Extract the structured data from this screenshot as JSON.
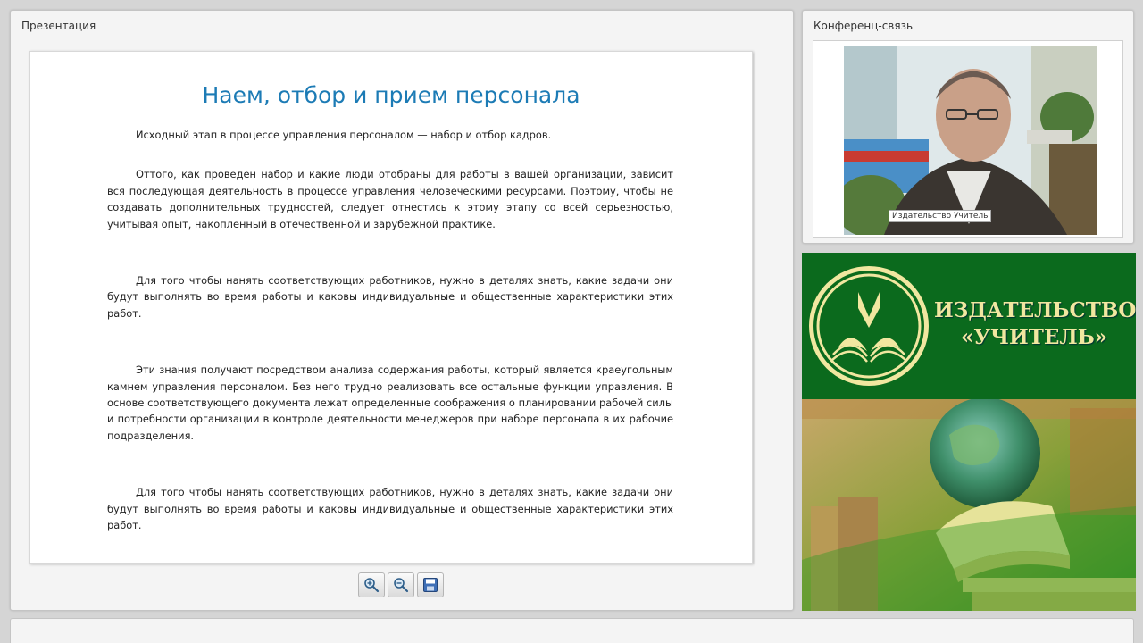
{
  "presentation": {
    "panel_title": "Презентация",
    "slide": {
      "title": "Наем, отбор и прием персонала",
      "paragraphs": [
        "Исходный этап в процессе управления персоналом — набор и отбор кадров.",
        "Оттого, как проведен набор и какие люди отобраны для работы в вашей организации, зависит вся последующая деятельность в процессе управления человеческими ресурсами. Поэтому, чтобы не создавать дополнительных трудностей, следует отнестись к этому этапу со всей серьезностью, учитывая опыт, накопленный в отечественной и зарубежной практике.",
        "Для того чтобы нанять соответствующих работников, нужно в деталях знать, какие задачи они будут выполнять во время работы и каковы индивидуальные и общественные характеристики этих работ.",
        "Эти знания получают посредством анализа содержания работы, который является краеугольным камнем управления персоналом. Без него трудно реализовать все остальные функции управления. В основе соответствующего документа лежат определенные соображения о планировании рабочей силы и потребности организации в контроле деятельности менеджеров при наборе персонала в их рабочие подразделения.",
        "Для того чтобы нанять соответствующих работников, нужно в деталях знать, какие задачи они будут выполнять во время работы и каковы индивидуальные и общественные характеристики этих работ."
      ]
    },
    "toolbar": {
      "zoom_in_icon": "zoom-in-icon",
      "zoom_out_icon": "zoom-out-icon",
      "save_icon": "save-icon"
    }
  },
  "conference": {
    "panel_title": "Конференц-связь",
    "speaker_label": "Издательство Учитель"
  },
  "banner": {
    "publisher_line1": "ИЗДАТЕЛЬСТВО",
    "publisher_line2": "«УЧИТЕЛЬ»"
  },
  "colors": {
    "slide_title": "#1c7bb5",
    "banner_green": "#0b6a1d",
    "banner_text": "#f1e7a0"
  }
}
